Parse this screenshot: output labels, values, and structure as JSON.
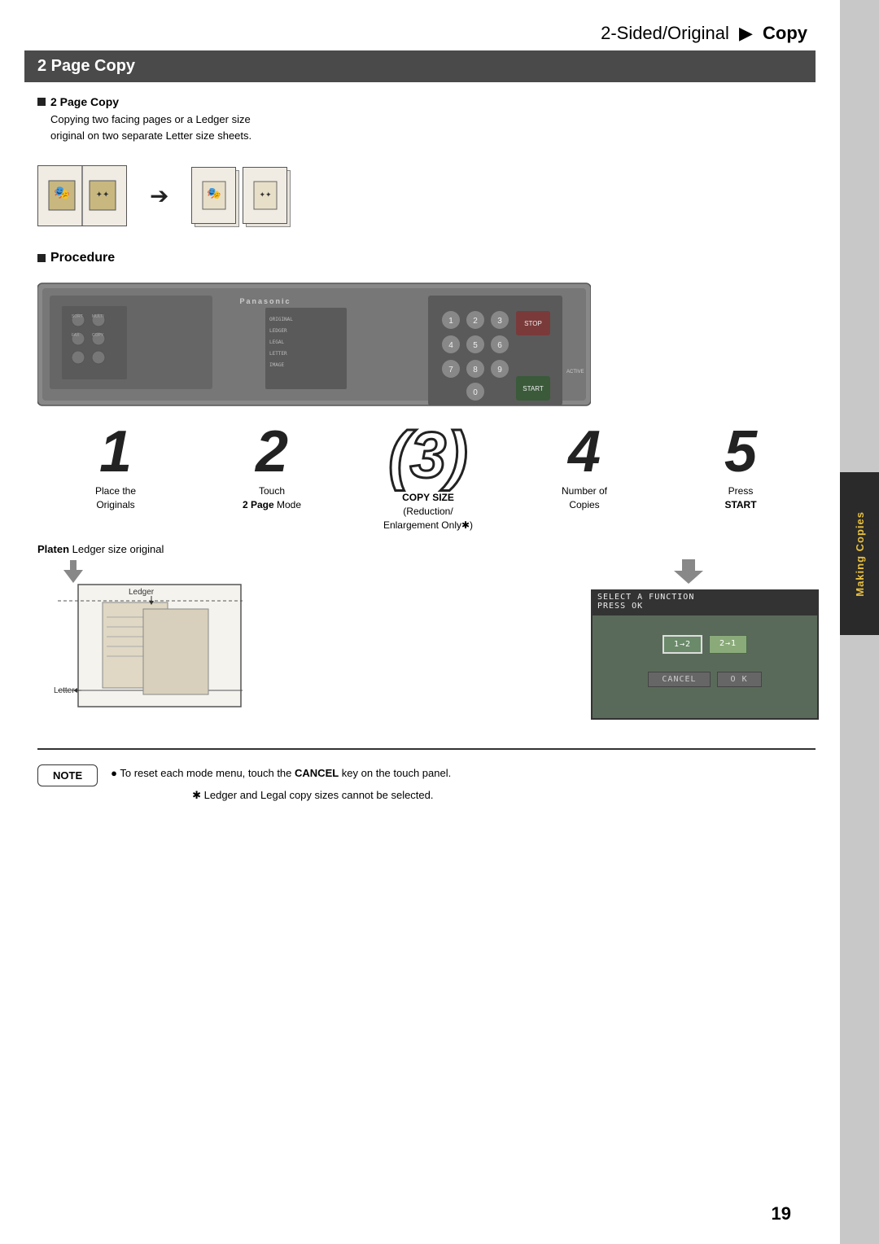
{
  "header": {
    "title": "2-Sided/Original",
    "arrow": "▶",
    "copy": "Copy"
  },
  "section": {
    "title": "2 Page Copy"
  },
  "sub_section": {
    "title": "2 Page Copy",
    "description_line1": "Copying two facing pages or a Ledger size",
    "description_line2": "original on two separate Letter size sheets."
  },
  "procedure": {
    "title": "Procedure"
  },
  "steps": [
    {
      "number": "1",
      "label_line1": "Place the",
      "label_line2": "Originals",
      "style": "normal"
    },
    {
      "number": "2",
      "label_line1": "Touch",
      "label_line2": "2 Page Mode",
      "label_bold": "2 Page",
      "style": "normal"
    },
    {
      "number": "(3)",
      "label_line1": "COPY SIZE",
      "label_line2": "(Reduction/",
      "label_line3": "Enlargement Only✱)",
      "style": "outlined"
    },
    {
      "number": "4",
      "label_line1": "Number of",
      "label_line2": "Copies",
      "style": "normal"
    },
    {
      "number": "5",
      "label_line1": "Press",
      "label_line2": "START",
      "label_bold": "START",
      "style": "normal"
    }
  ],
  "platen": {
    "label": "Platen",
    "ledger_label": "Ledger size original",
    "ledger_arrow_label": "Ledger",
    "letter_label": "Letter"
  },
  "screen": {
    "top_text": "SELECT A FUNCTION\nPRESS OK",
    "option1": "1→2",
    "option2": "2→1",
    "cancel_btn": "CANCEL",
    "ok_btn": "O K"
  },
  "note": {
    "label": "NOTE",
    "bullet": "●",
    "text1": "To reset each mode menu, touch the ",
    "text1_bold": "CANCEL",
    "text1_end": " key on the touch panel.",
    "asterisk_text": "✱  Ledger and Legal copy sizes cannot be selected."
  },
  "page_number": "19",
  "sidebar": {
    "tab_label": "Making Copies"
  }
}
